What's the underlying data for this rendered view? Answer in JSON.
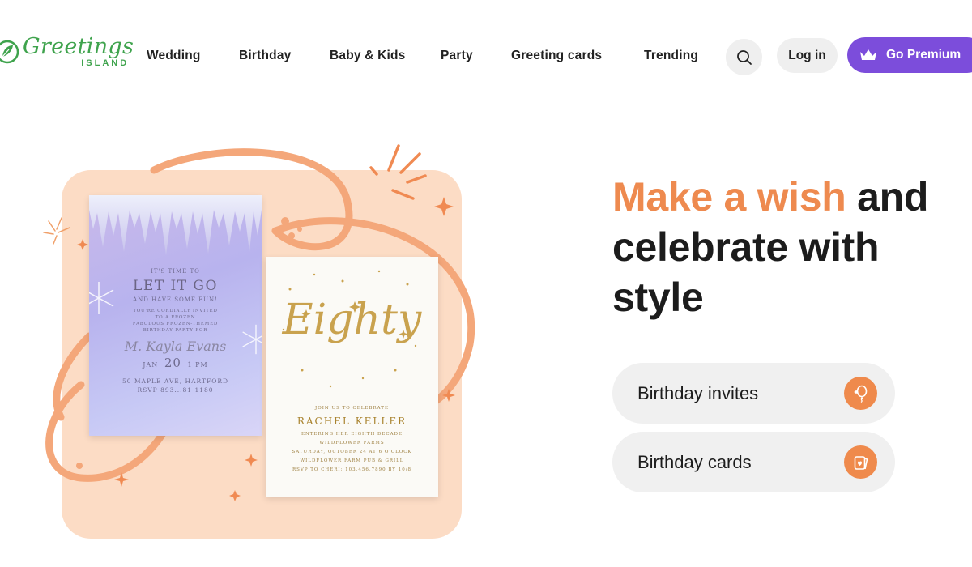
{
  "brand": {
    "logo_script": "Greetings",
    "logo_sub": "ISLAND",
    "brand_color": "#3fa34d"
  },
  "nav": {
    "items": [
      {
        "label": "Wedding"
      },
      {
        "label": "Birthday"
      },
      {
        "label": "Baby & Kids"
      },
      {
        "label": "Party"
      },
      {
        "label": "Greeting cards"
      },
      {
        "label": "Trending"
      }
    ],
    "search_icon": "search-icon",
    "login_label": "Log in",
    "premium_label": "Go Premium",
    "premium_icon": "crown-icon",
    "premium_color": "#7c4ddb"
  },
  "hero": {
    "headline_accent": "Make a wish",
    "headline_rest": " and celebrate with style",
    "accent_color": "#ee8a4f",
    "links": [
      {
        "label": "Birthday invites",
        "icon": "balloon-icon"
      },
      {
        "label": "Birthday cards",
        "icon": "card-icon"
      }
    ]
  },
  "card_frozen": {
    "line1": "IT'S TIME TO",
    "title": "LET IT GO",
    "line2": "AND HAVE SOME FUN!",
    "invite_1": "YOU'RE CORDIALLY INVITED",
    "invite_2": "TO A FROZEN",
    "invite_3": "FABULOUS FROZEN-THEMED",
    "invite_4": "BIRTHDAY PARTY FOR",
    "name": "M. Kayla Evans",
    "month": "JAN",
    "day": "20",
    "time": "1 PM",
    "address": "50 MAPLE AVE, HARTFORD",
    "rsvp": "RSVP 893...81 1180"
  },
  "card_eighty": {
    "script": "Eighty",
    "join": "JOIN US TO CELEBRATE",
    "name": "RACHEL KELLER",
    "entering": "ENTERING HER EIGHTH DECADE",
    "venue": "WILDFLOWER FARMS",
    "date": "SATURDAY, OCTOBER 24 AT 6 O'CLOCK",
    "place": "WILDFLOWER FARM PUB & GRILL",
    "rsvp": "RSVP TO CHERI: 103.456.7890 BY 10/8"
  }
}
